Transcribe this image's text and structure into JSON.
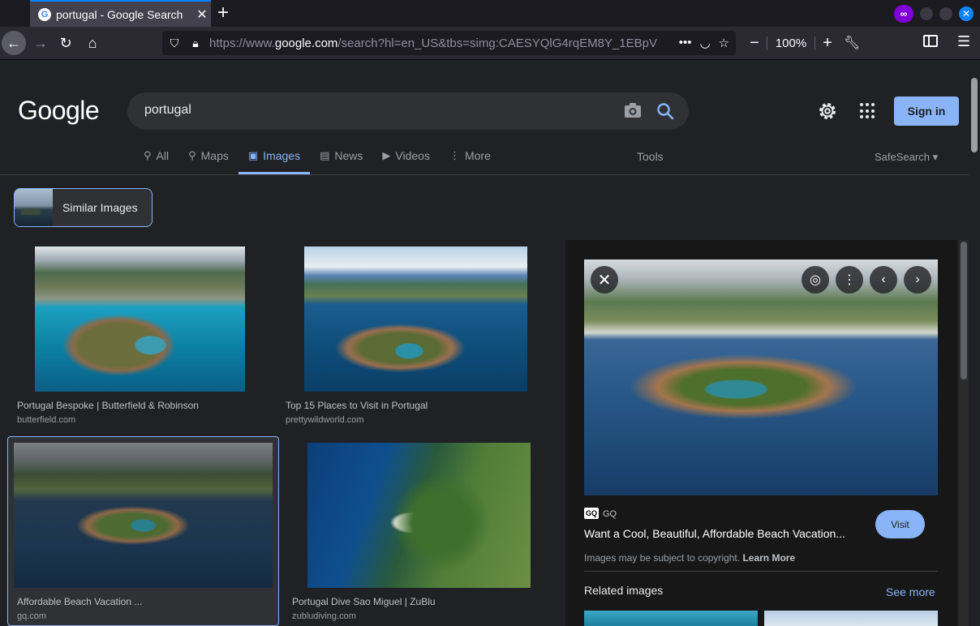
{
  "browser": {
    "tab_title": "portugal - Google Search",
    "url_prefix": "https://www.",
    "url_domain": "google.com",
    "url_rest": "/search?hl=en_US&tbs=simg:CAESYQlG4rqEM8Y_1EBpV",
    "zoom": "100%",
    "icons": [
      "back-icon",
      "forward-icon",
      "reload-icon",
      "home-icon",
      "shield-icon",
      "lock-icon",
      "more-icon",
      "pocket-icon",
      "star-icon",
      "zoom-out-icon",
      "zoom-in-icon",
      "wrench-icon",
      "sidebar-icon",
      "menu-icon",
      "private-browsing-icon"
    ]
  },
  "google": {
    "logo": "Google",
    "query": "portugal",
    "signin_label": "Sign in",
    "tabs": [
      {
        "label": "All",
        "icon": "search-icon",
        "active": false
      },
      {
        "label": "Maps",
        "icon": "pin-icon",
        "active": false
      },
      {
        "label": "Images",
        "icon": "image-icon",
        "active": true
      },
      {
        "label": "News",
        "icon": "news-icon",
        "active": false
      },
      {
        "label": "Videos",
        "icon": "play-icon",
        "active": false
      },
      {
        "label": "More",
        "icon": "dots-icon",
        "active": false
      }
    ],
    "tools_label": "Tools",
    "safesearch_label": "SafeSearch",
    "similar_label": "Similar Images",
    "accent": "#8ab4f8"
  },
  "results": [
    {
      "caption": "Portugal Bespoke | Butterfield & Robinson",
      "source": "butterfield.com"
    },
    {
      "caption": "Top 15 Places to Visit in Portugal",
      "source": "prettywildworld.com"
    },
    {
      "caption": "Affordable Beach Vacation ...",
      "source": "gq.com"
    },
    {
      "caption": "Portugal Dive Sao Miguel | ZuBlu",
      "source": "zubludiving.com"
    }
  ],
  "panel": {
    "source_logo": "GQ",
    "source_name": "GQ",
    "title": "Want a Cool, Beautiful, Affordable Beach Vacation...",
    "visit_label": "Visit",
    "copyright_text": "Images may be subject to copyright.",
    "learn_more": "Learn More",
    "related_label": "Related images",
    "see_more": "See more"
  }
}
